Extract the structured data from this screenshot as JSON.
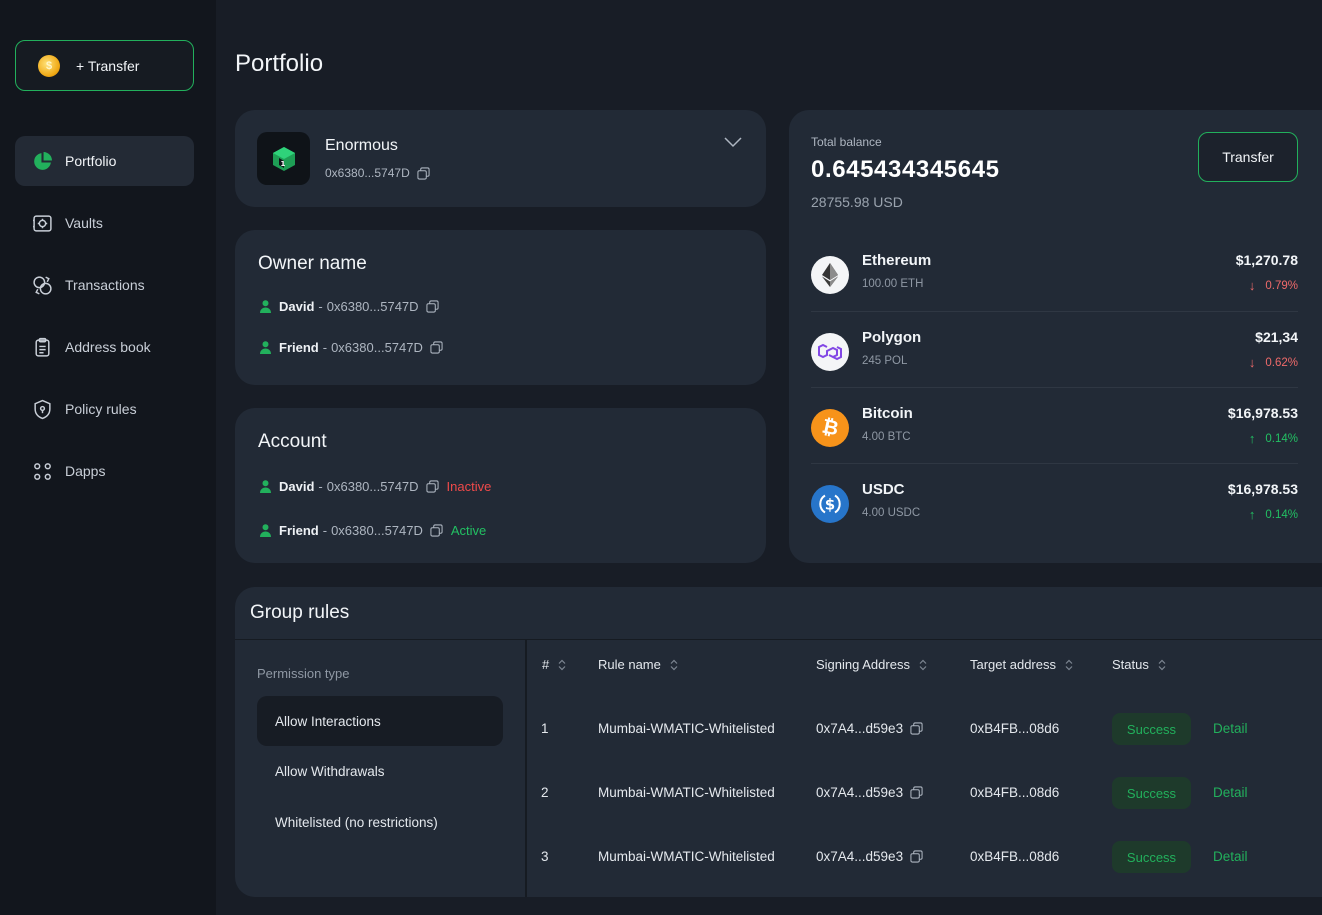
{
  "sidebar": {
    "transfer_label": "+ Transfer",
    "items": [
      {
        "label": "Portfolio",
        "icon": "pie-chart-icon",
        "active": true
      },
      {
        "label": "Vaults",
        "icon": "vault-icon",
        "active": false
      },
      {
        "label": "Transactions",
        "icon": "transactions-icon",
        "active": false
      },
      {
        "label": "Address book",
        "icon": "clipboard-icon",
        "active": false
      },
      {
        "label": "Policy rules",
        "icon": "shield-icon",
        "active": false
      },
      {
        "label": "Dapps",
        "icon": "grid-dots-icon",
        "active": false
      }
    ]
  },
  "page": {
    "title": "Portfolio"
  },
  "wallet": {
    "name": "Enormous",
    "address": "0x6380...5747D"
  },
  "owner": {
    "title": "Owner name",
    "people": [
      {
        "name": "David",
        "address": "0x6380...5747D"
      },
      {
        "name": "Friend",
        "address": "0x6380...5747D"
      }
    ]
  },
  "account": {
    "title": "Account",
    "people": [
      {
        "name": "David",
        "address": "0x6380...5747D",
        "status": "Inactive"
      },
      {
        "name": "Friend",
        "address": "0x6380...5747D",
        "status": "Active"
      }
    ]
  },
  "balance": {
    "label": "Total balance",
    "value": "0.645434345645",
    "usd": "28755.98 USD",
    "transfer_label": "Transfer",
    "assets": [
      {
        "name": "Ethereum",
        "amount": "100.00 ETH",
        "usd": "$1,270.78",
        "change": "0.79%",
        "direction": "down",
        "icon": "ethereum-icon"
      },
      {
        "name": "Polygon",
        "amount": "245 POL",
        "usd": "$21,34",
        "change": "0.62%",
        "direction": "down",
        "icon": "polygon-icon"
      },
      {
        "name": "Bitcoin",
        "amount": "4.00 BTC",
        "usd": "$16,978.53",
        "change": "0.14%",
        "direction": "up",
        "icon": "bitcoin-icon"
      },
      {
        "name": "USDC",
        "amount": "4.00 USDC",
        "usd": "$16,978.53",
        "change": "0.14%",
        "direction": "up",
        "icon": "usdc-icon"
      }
    ]
  },
  "rules": {
    "title": "Group rules",
    "permission_label": "Permission type",
    "permissions": [
      {
        "label": "Allow Interactions",
        "active": true
      },
      {
        "label": "Allow Withdrawals",
        "active": false
      },
      {
        "label": "Whitelisted (no restrictions)",
        "active": false
      }
    ],
    "columns": [
      "#",
      "Rule name",
      "Signing Address",
      "Target address",
      "Status"
    ],
    "rows": [
      {
        "num": "1",
        "rule": "Mumbai-WMATIC-Whitelisted",
        "signing": "0x7A4...d59e3",
        "target": "0xB4FB...08d6",
        "status": "Success",
        "action": "Detail"
      },
      {
        "num": "2",
        "rule": "Mumbai-WMATIC-Whitelisted",
        "signing": "0x7A4...d59e3",
        "target": "0xB4FB...08d6",
        "status": "Success",
        "action": "Detail"
      },
      {
        "num": "3",
        "rule": "Mumbai-WMATIC-Whitelisted",
        "signing": "0x7A4...d59e3",
        "target": "0xB4FB...08d6",
        "status": "Success",
        "action": "Detail"
      }
    ]
  },
  "colors": {
    "accent": "#22b05c",
    "negative": "#ef4a4a",
    "background": "#181d26",
    "card": "#222a36",
    "sidebar": "#12161d"
  }
}
